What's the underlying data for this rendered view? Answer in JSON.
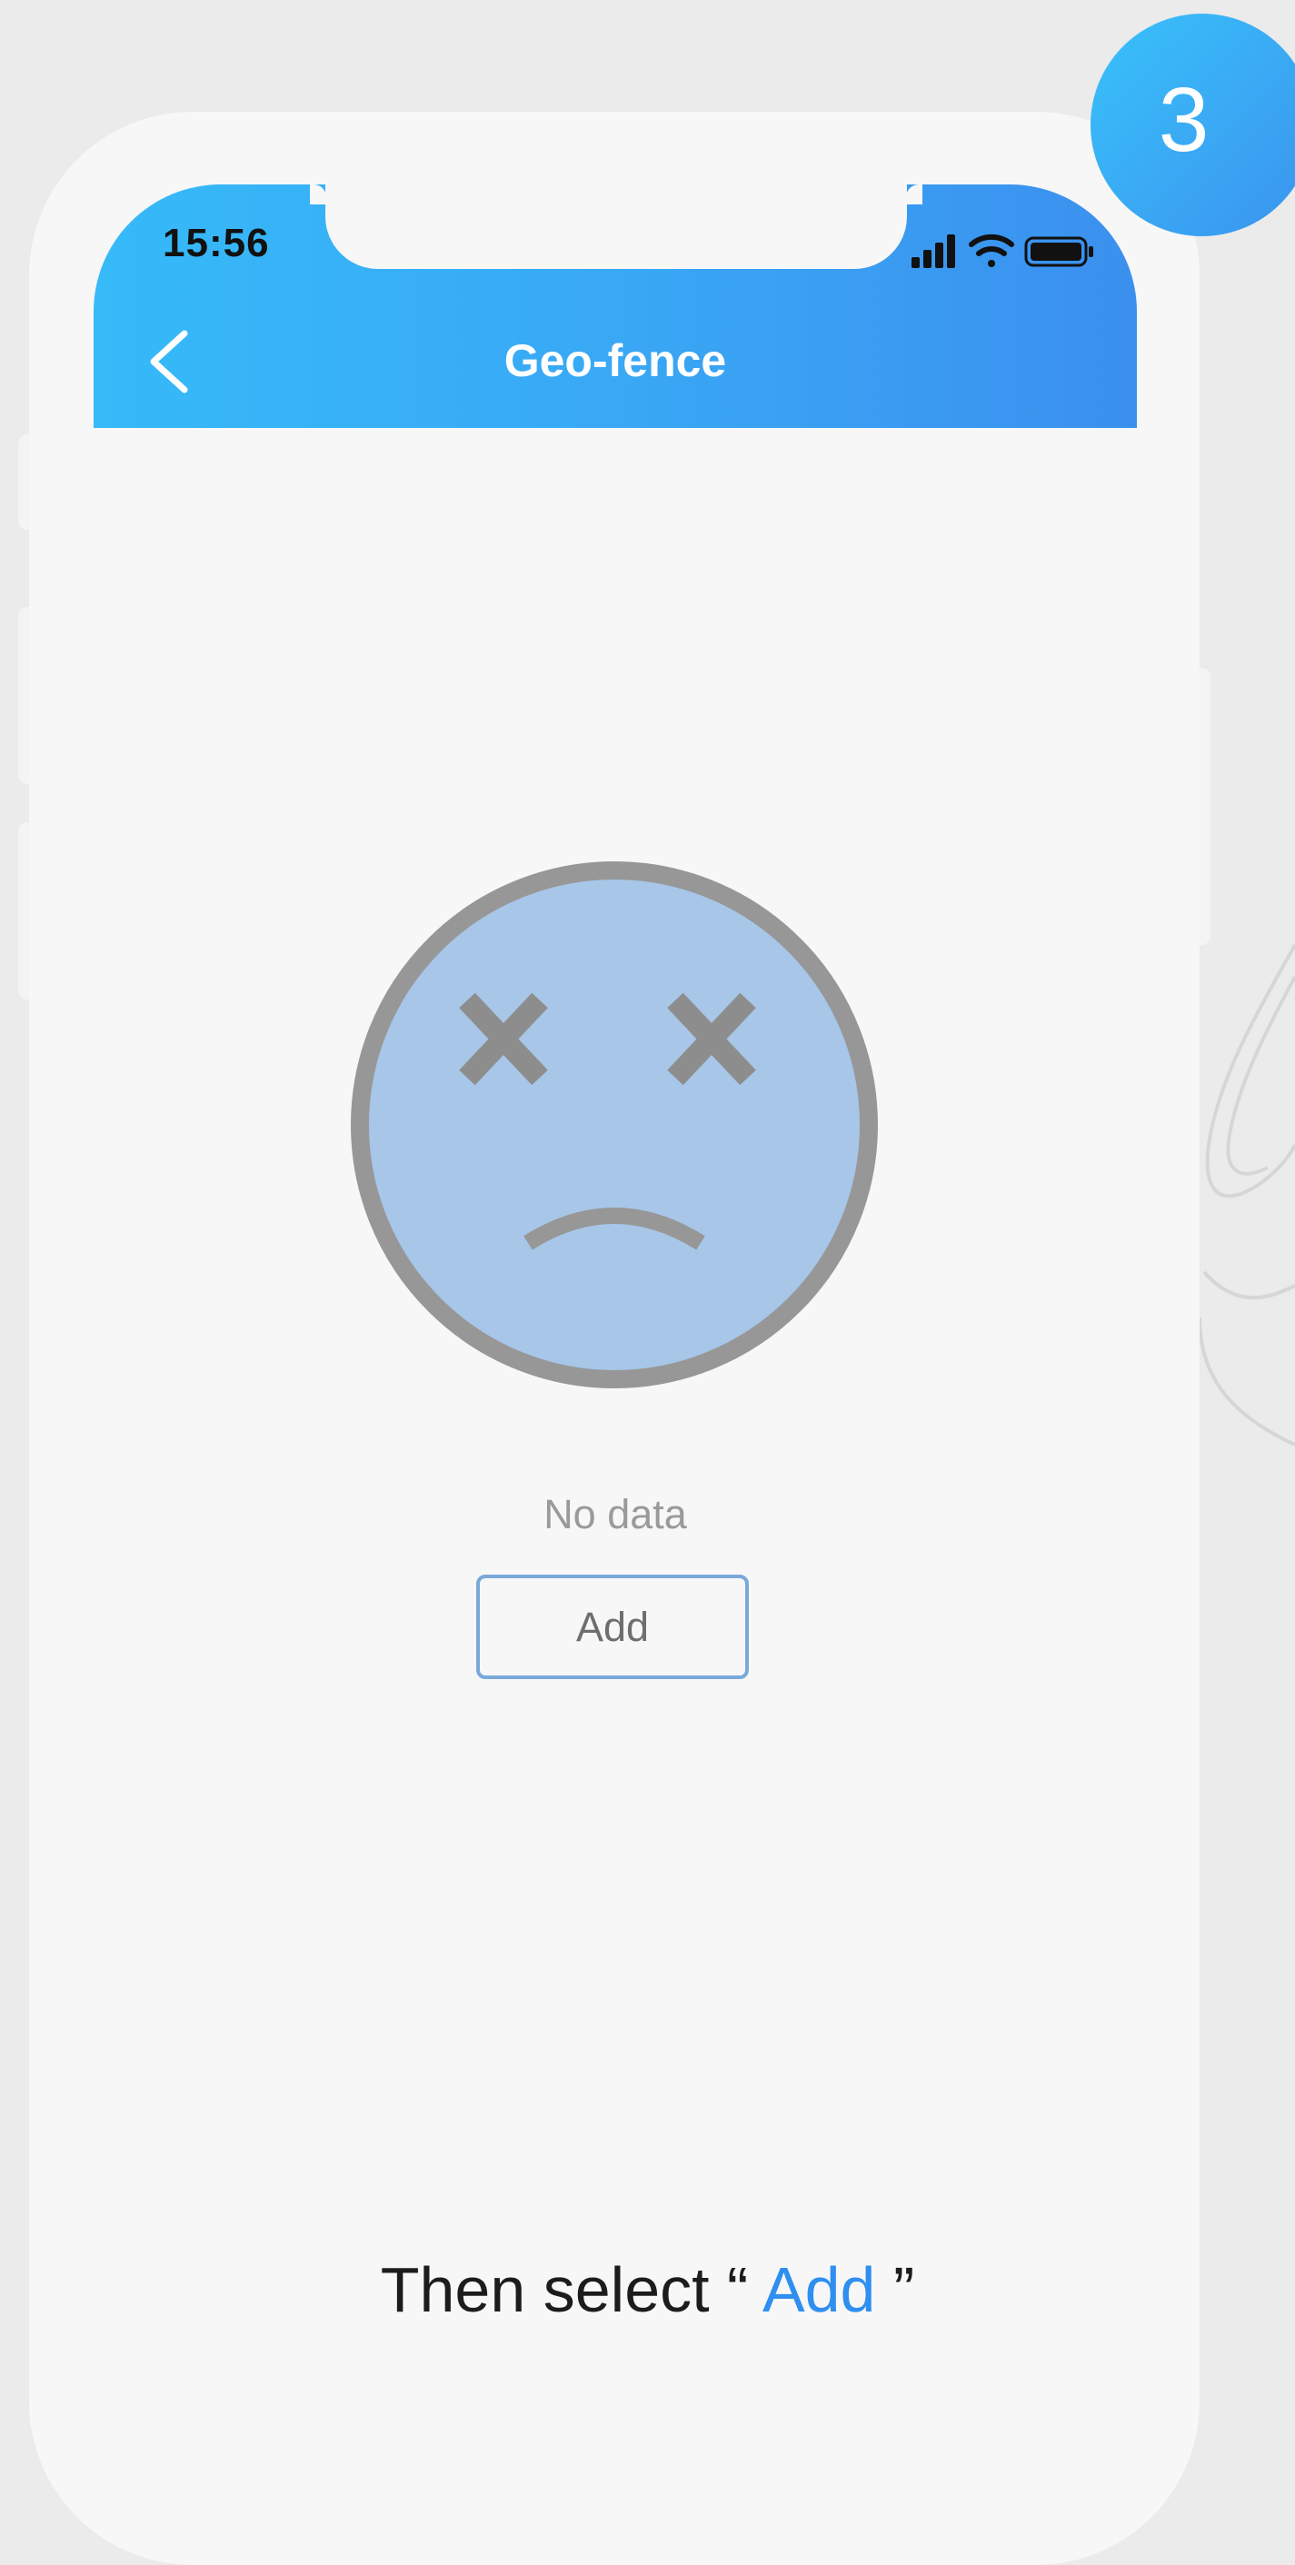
{
  "status_bar": {
    "time": "15:56"
  },
  "nav": {
    "title": "Geo-fence",
    "back_icon": "chevron-left-icon"
  },
  "empty_state": {
    "icon": "sad-face-icon",
    "text": "No data"
  },
  "add_button": {
    "label": "Add"
  },
  "caption": {
    "prefix": "Then select “ ",
    "highlight": "Add",
    "suffix": " ”"
  },
  "step_badge": {
    "number": "3"
  },
  "colors": {
    "header_gradient_start": "#36baf8",
    "header_gradient_end": "#3b90ee",
    "highlight": "#2f8ff0",
    "button_border": "#7aa9d9",
    "face_fill": "#a7c6e8",
    "face_stroke": "#979797"
  }
}
